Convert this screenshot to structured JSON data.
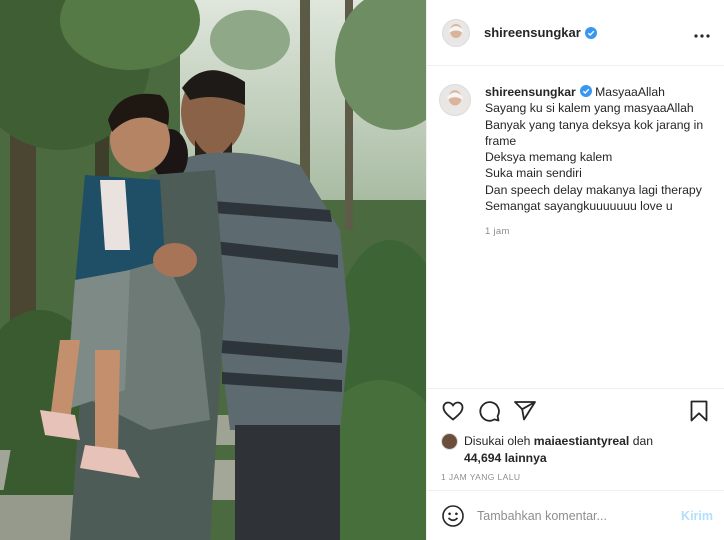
{
  "post": {
    "image_alt": "family photo",
    "header": {
      "username": "shireensungkar",
      "verified": true,
      "more_icon": "more-horizontal-icon"
    },
    "caption": {
      "username": "shireensungkar",
      "lines": [
        "MasyaaAllah",
        "Sayang ku si kalem yang masyaaAllah",
        "Banyak yang tanya deksya kok jarang in frame",
        "Deksya memang kalem",
        "Suka main sendiri",
        "Dan speech delay makanya lagi therapy",
        "Semangat sayangkuuuuuuu love u"
      ],
      "time": "1 jam"
    },
    "actions": {
      "icons": [
        "heart-icon",
        "comment-icon",
        "share-icon",
        "bookmark-icon"
      ]
    },
    "likes": {
      "prefix": "Disukai oleh",
      "user": "maiaestiantyreal",
      "joiner": "dan",
      "count": "44,694",
      "suffix": "lainnya"
    },
    "time_ago": "1 JAM YANG LALU",
    "comment": {
      "placeholder": "Tambahkan komentar...",
      "post_label": "Kirim"
    },
    "colors": {
      "verified": "#3897f0",
      "post_disabled": "#b2dffc",
      "muted": "#8e8e8e"
    }
  }
}
